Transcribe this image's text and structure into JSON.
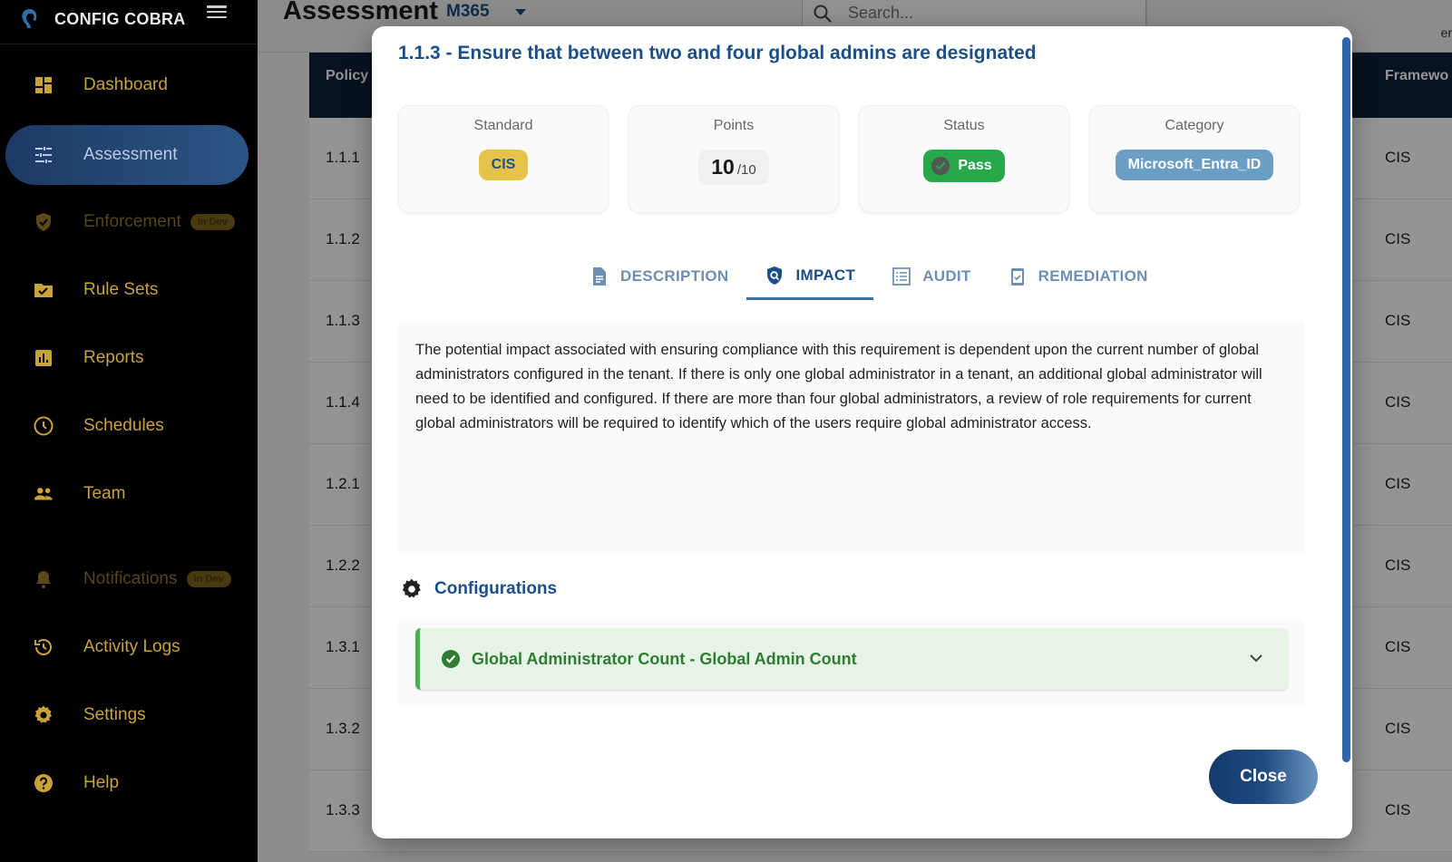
{
  "app": {
    "name": "CONFIG COBRA"
  },
  "sidebar": {
    "items": [
      {
        "label": "Dashboard",
        "icon": "dashboard-icon"
      },
      {
        "label": "Assessment",
        "icon": "sliders-icon",
        "active": true
      },
      {
        "label": "Enforcement",
        "icon": "shield-check-icon",
        "badge": "In Dev"
      },
      {
        "label": "Rule Sets",
        "icon": "folder-check-icon"
      },
      {
        "label": "Reports",
        "icon": "bar-chart-icon"
      },
      {
        "label": "Schedules",
        "icon": "clock-icon"
      },
      {
        "label": "Team",
        "icon": "people-icon"
      },
      {
        "label": "Notifications",
        "icon": "bell-icon",
        "badge": "In Dev"
      },
      {
        "label": "Activity Logs",
        "icon": "history-icon"
      },
      {
        "label": "Settings",
        "icon": "gear-icon"
      },
      {
        "label": "Help",
        "icon": "help-circle-icon"
      }
    ]
  },
  "header": {
    "title": "Assessment",
    "tenant": "M365",
    "search_placeholder": "Search...",
    "right_text": "er"
  },
  "table": {
    "col_policy": "Policy",
    "col_framework": "Framewo",
    "rows": [
      {
        "id": "1.1.1",
        "framework": "CIS"
      },
      {
        "id": "1.1.2",
        "framework": "CIS"
      },
      {
        "id": "1.1.3",
        "framework": "CIS"
      },
      {
        "id": "1.1.4",
        "framework": "CIS"
      },
      {
        "id": "1.2.1",
        "framework": "CIS"
      },
      {
        "id": "1.2.2",
        "framework": "CIS"
      },
      {
        "id": "1.3.1",
        "framework": "CIS"
      },
      {
        "id": "1.3.2",
        "framework": "CIS"
      },
      {
        "id": "1.3.3",
        "framework": "CIS"
      }
    ]
  },
  "modal": {
    "title": "1.1.3 - Ensure that between two and four global admins are designated",
    "standard": {
      "label": "Standard",
      "value": "CIS"
    },
    "points": {
      "label": "Points",
      "value": "10",
      "total": "/10"
    },
    "status": {
      "label": "Status",
      "value": "Pass"
    },
    "category": {
      "label": "Category",
      "value": "Microsoft_Entra_ID"
    },
    "tabs": [
      {
        "label": "DESCRIPTION",
        "icon": "document-icon"
      },
      {
        "label": "IMPACT",
        "icon": "shield-search-icon",
        "active": true
      },
      {
        "label": "AUDIT",
        "icon": "list-icon"
      },
      {
        "label": "REMEDIATION",
        "icon": "clipboard-check-icon"
      }
    ],
    "impact_text": "The potential impact associated with ensuring compliance with this requirement is dependent upon the current number of global administrators configured in the tenant. If there is only one global administrator in a tenant, an additional global administrator will need to be identified and configured. If there are more than four global administrators, a review of role requirements for current global administrators will be required to identify which of the users require global administrator access.",
    "configurations_title": "Configurations",
    "configuration_item": "Global Administrator Count - Global Admin Count",
    "close_label": "Close"
  },
  "colors": {
    "accent": "#1b4f8a",
    "gold": "#c9a33a",
    "pass": "#27a84a",
    "category": "#6a9ec4"
  }
}
